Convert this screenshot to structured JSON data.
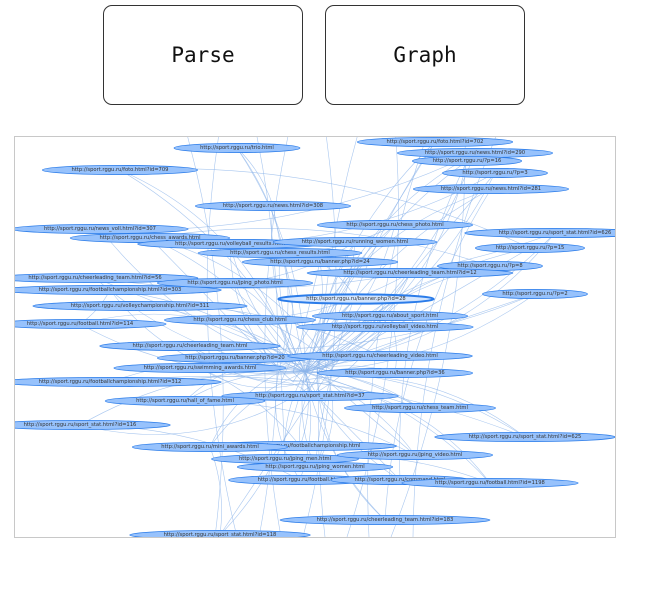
{
  "toolbar": {
    "parse_label": "Parse",
    "graph_label": "Graph"
  },
  "graph": {
    "colors": {
      "node_fill": "#97c2fc",
      "node_border": "#2b7ce9",
      "edge": "#8cb4ea",
      "selected_fill": "#d2e5ff"
    },
    "selected_node": "http://sport.rggu.ru/banner.php?id=28",
    "nodes": [
      "http://sport.rggu.ru/trio.html",
      "http://sport.rggu.ru/foto.html?id=702",
      "http://sport.rggu.ru/news.html?id=290",
      "http://sport.rggu.ru/?p=16",
      "http://sport.rggu.ru/?p=3",
      "http://sport.rggu.ru/news.html?id=281",
      "http://sport.rggu.ru/foto.html?id=709",
      "http://sport.rggu.ru/news.html?id=308",
      "http://sport.rggu.ru/chess_photo.html",
      "http://sport.rggu.ru/news_voll.html?id=307",
      "http://sport.rggu.ru/chess_awards.html",
      "http://sport.rggu.ru/volleyball_results.html",
      "http://sport.rggu.ru/sport_stat.html?id=626",
      "http://sport.rggu.ru/?p=15",
      "http://sport.rggu.ru/running_women.html",
      "http://sport.rggu.ru/chess_results.html",
      "http://sport.rggu.ru/banner.php?id=24",
      "http://sport.rggu.ru/?p=8",
      "http://sport.rggu.ru/cheerleading_team.html?id=12",
      "http://sport.rggu.ru/cheerleading_team.html?id=56",
      "http://sport.rggu.ru/footballchampionship.html?id=303",
      "http://sport.rggu.ru/jping_photo.html",
      "http://sport.rggu.ru/?p=2",
      "http://sport.rggu.ru/banner.php?id=28",
      "http://sport.rggu.ru/volleychampionship.html?id=311",
      "http://sport.rggu.ru/chess_club.html",
      "http://sport.rggu.ru/about_sport.html",
      "http://sport.rggu.ru/football.html?id=114",
      "http://sport.rggu.ru/volleyball_video.html",
      "http://sport.rggu.ru/cheerleading_team.html",
      "http://sport.rggu.ru/banner.php?id=20",
      "http://sport.rggu.ru/cheerleading_video.html",
      "http://sport.rggu.ru/swimming_awards.html",
      "http://sport.rggu.ru/banner.php?id=36",
      "http://sport.rggu.ru/footballchampionship.html?id=312",
      "http://sport.rggu.ru/sport_stat.html?id=37",
      "http://sport.rggu.ru/hall_of_fame.html",
      "http://sport.rggu.ru/chess_team.html",
      "http://sport.rggu.ru/sport_stat.html?id=116",
      "http://sport.rggu.ru/footballchampionship.html",
      "http://sport.rggu.ru/jping_men.html",
      "http://sport.rggu.ru/sport_stat.html?id=625",
      "http://sport.rggu.ru/mini_awards.html",
      "http://sport.rggu.ru/jping_video.html",
      "http://sport.rggu.ru/jping_women.html",
      "http://sport.rggu.ru/football.html",
      "http://sport.rggu.ru/command.html",
      "http://sport.rggu.ru/football.html?id=1198",
      "http://sport.rggu.ru/cheerleading_team.html?id=183",
      "http://sport.rggu.ru/sport_stat.html?id=118"
    ]
  }
}
